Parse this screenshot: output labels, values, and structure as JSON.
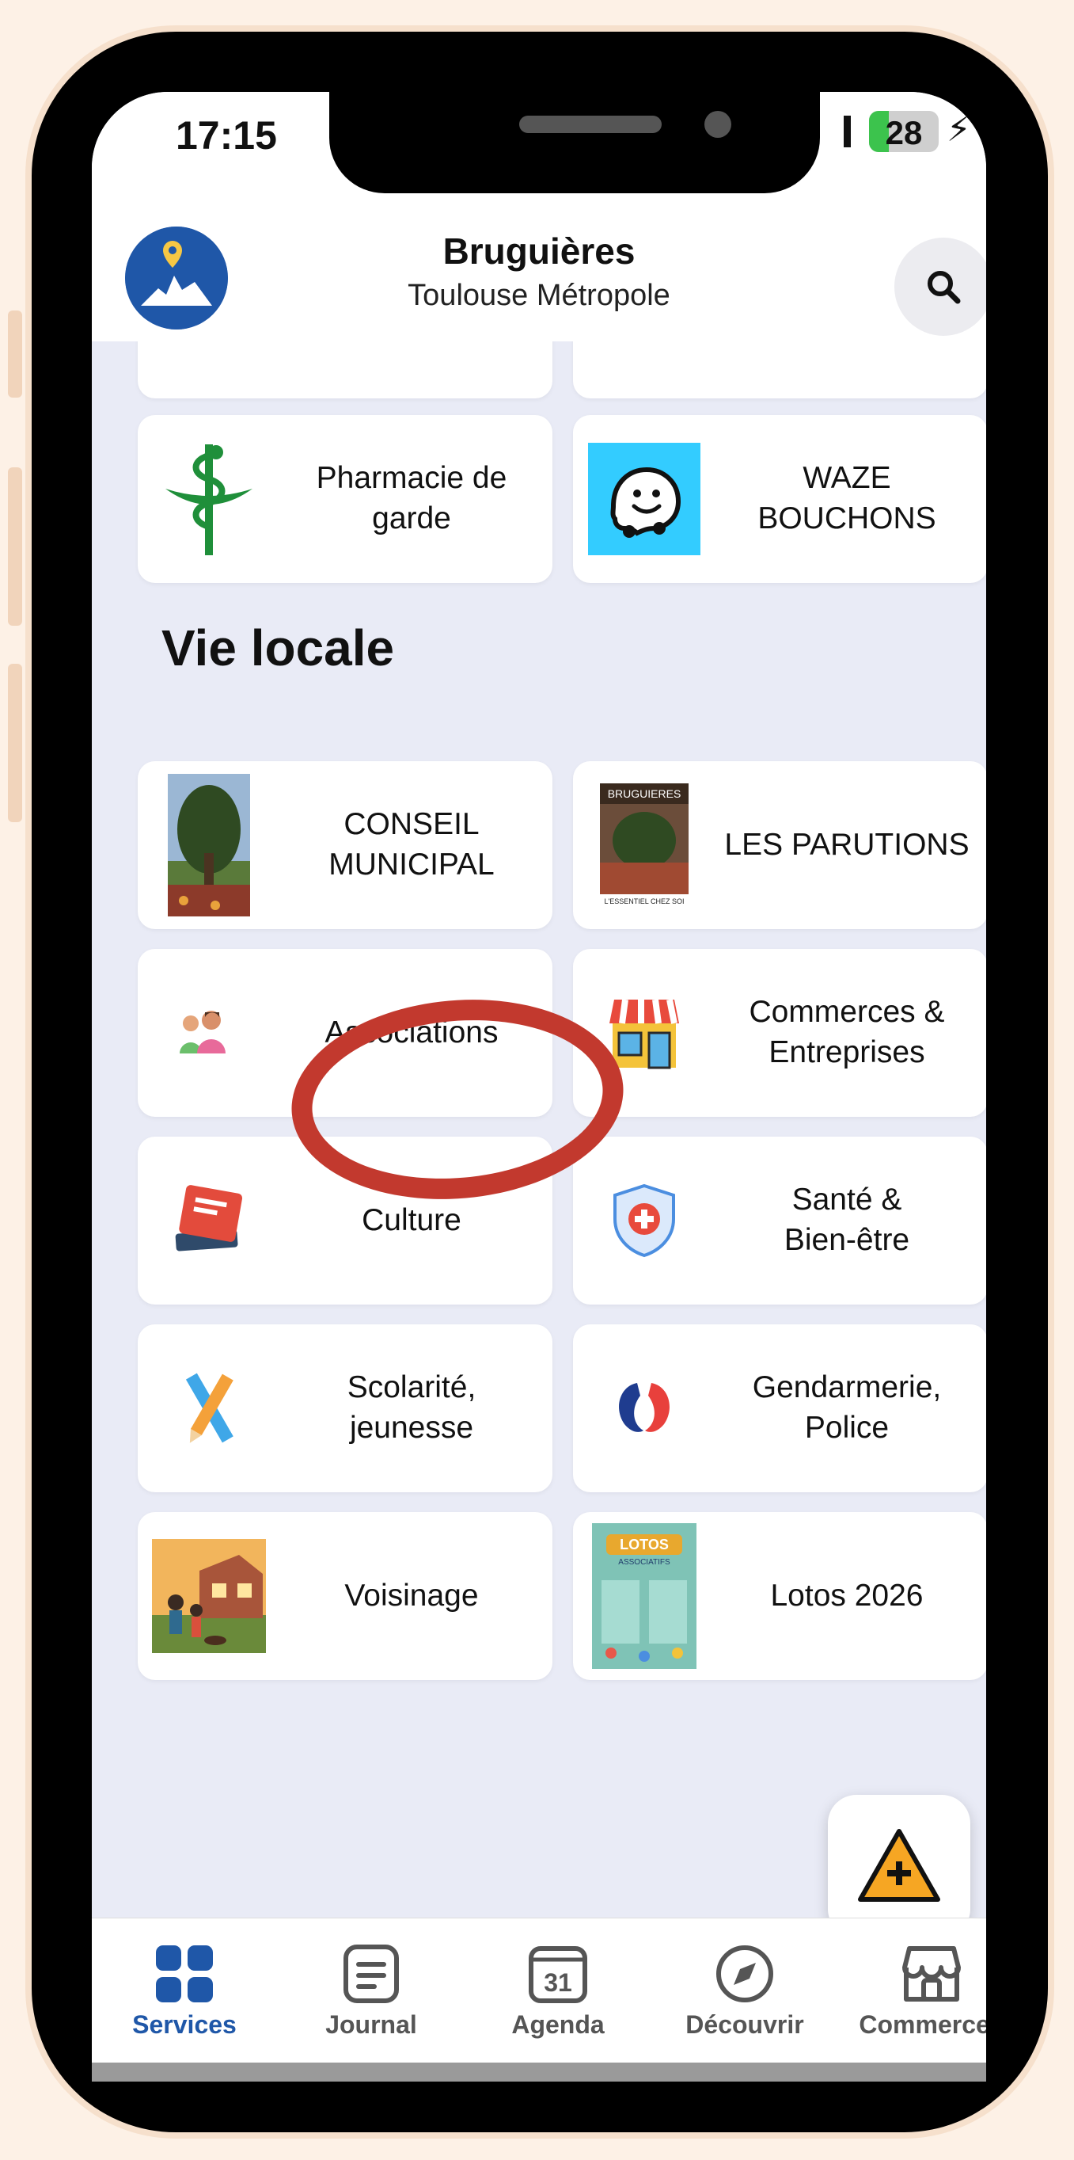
{
  "status_bar": {
    "time": "17:15",
    "battery_level": "28",
    "battery_fraction": 0.28
  },
  "header": {
    "title": "Bruguières",
    "subtitle": "Toulouse Métropole"
  },
  "top_cards": [
    {
      "label": "Pharmacie de\ngarde",
      "icon": "pharmacy-caduceus-icon"
    },
    {
      "label": "WAZE\nBOUCHONS",
      "icon": "waze-icon"
    }
  ],
  "section": {
    "title": "Vie locale"
  },
  "vie_locale_cards": [
    {
      "label": "CONSEIL\nMUNICIPAL",
      "icon": "conseil-photo"
    },
    {
      "label": "LES PARUTIONS",
      "icon": "parutions-cover"
    },
    {
      "label": "Associations",
      "icon": "people-icon"
    },
    {
      "label": "Commerces &\nEntreprises",
      "icon": "shop-icon"
    },
    {
      "label": "Culture",
      "icon": "book-icon"
    },
    {
      "label": "Santé &\nBien-être",
      "icon": "health-shield-icon"
    },
    {
      "label": "Scolarité,\njeunesse",
      "icon": "pencil-ruler-icon"
    },
    {
      "label": "Gendarmerie,\nPolice",
      "icon": "police-emblem-icon"
    },
    {
      "label": "Voisinage",
      "icon": "neighbourhood-photo"
    },
    {
      "label": "Lotos 2026",
      "icon": "lotos-poster"
    }
  ],
  "parutions_cover_text": [
    "BRUGUIERES",
    "L'ESSENTIEL CHEZ SOI"
  ],
  "lotos_poster_text": [
    "LOTOS",
    "ASSOCIATIFS"
  ],
  "tabs": [
    {
      "label": "Services",
      "icon": "services-grid-icon",
      "active": true
    },
    {
      "label": "Journal",
      "icon": "journal-icon",
      "active": false
    },
    {
      "label": "Agenda",
      "icon": "calendar-icon",
      "active": false,
      "icon_text": "31"
    },
    {
      "label": "Découvrir",
      "icon": "compass-icon",
      "active": false
    },
    {
      "label": "Commerces",
      "icon": "store-icon",
      "active": false
    }
  ],
  "colors": {
    "accent": "#1f57a8",
    "highlight": "#c2392e",
    "alert_fab": "#f6a623"
  }
}
